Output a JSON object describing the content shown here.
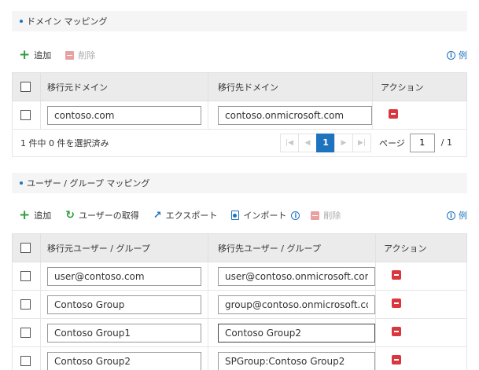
{
  "domain_section": {
    "title": "ドメイン マッピング",
    "toolbar": {
      "add_label": "追加",
      "delete_label": "削除",
      "example_label": "例"
    },
    "columns": [
      "移行元ドメイン",
      "移行先ドメイン",
      "アクション"
    ],
    "rows": [
      {
        "source": "contoso.com",
        "target": "contoso.onmicrosoft.com"
      }
    ],
    "selection_status": "1 件中 0 件を選択済み",
    "pager": {
      "current_page": "1",
      "page_label": "ページ",
      "page_input": "1",
      "total": "/ 1"
    }
  },
  "user_section": {
    "title": "ユーザー / グループ マッピング",
    "toolbar": {
      "add_label": "追加",
      "fetch_users_label": "ユーザーの取得",
      "export_label": "エクスポート",
      "import_label": "インポート",
      "delete_label": "削除",
      "example_label": "例"
    },
    "columns": [
      "移行元ユーザー / グループ",
      "移行先ユーザー / グループ",
      "アクション"
    ],
    "rows": [
      {
        "source": "user@contoso.com",
        "target": "user@contoso.onmicrosoft.com"
      },
      {
        "source": "Contoso Group",
        "target": "group@contoso.onmicrosoft.com"
      },
      {
        "source": "Contoso Group1",
        "target": "Contoso Group2"
      },
      {
        "source": "Contoso Group2",
        "target": "SPGroup:Contoso Group2"
      }
    ]
  },
  "icons": {
    "add": "plus-icon",
    "delete": "minus-box-icon",
    "info": "info-circle-icon",
    "fetch": "refresh-icon",
    "export": "share-arrow-icon",
    "import": "import-file-icon",
    "row_delete": "remove-icon"
  },
  "colors": {
    "accent": "#1e73be",
    "add_green": "#2e9e3e",
    "delete_red": "#d9363e",
    "header_bg": "#ebebeb"
  }
}
